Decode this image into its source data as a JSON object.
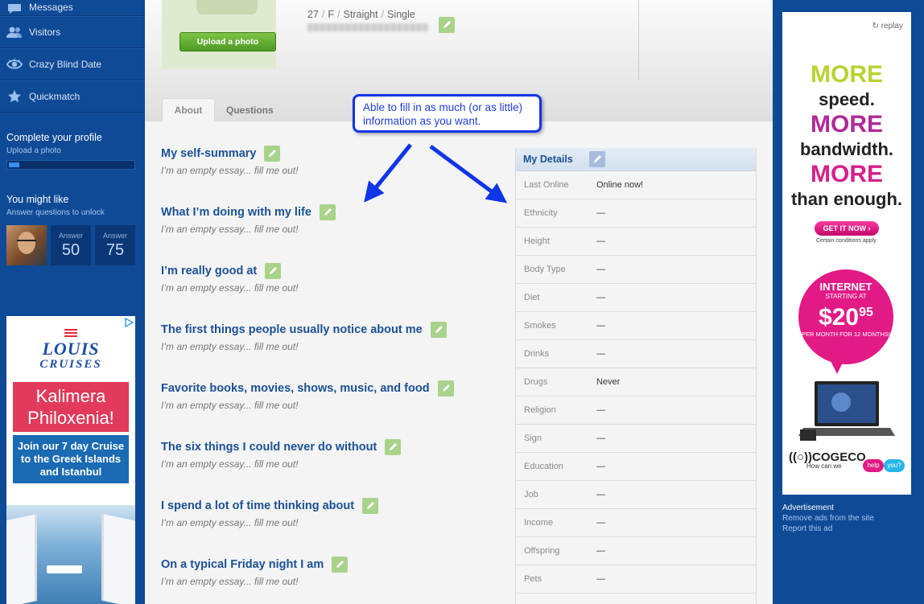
{
  "sidebar": {
    "nav": [
      {
        "label": "Messages",
        "icon": "message-icon"
      },
      {
        "label": "Visitors",
        "icon": "visitors-icon"
      },
      {
        "label": "Crazy Blind Date",
        "icon": "eye-icon"
      },
      {
        "label": "Quickmatch",
        "icon": "star-icon"
      }
    ],
    "complete_profile": {
      "title": "Complete your profile",
      "link": "Upload a photo",
      "progress": 0.08
    },
    "might_like": {
      "title": "You might like",
      "link": "Answer questions to unlock",
      "boxes": [
        {
          "label": "Answer",
          "count": "50"
        },
        {
          "label": "Answer",
          "count": "75"
        }
      ]
    },
    "ad": {
      "brand": "LOUIS",
      "brand_sub": "CRUISES",
      "headline": "Kalimera Philoxenia!",
      "body": "Join our 7 day Cruise to the Greek Islands and Istanbul"
    }
  },
  "profile": {
    "upload_button": "Upload a photo",
    "age": "27",
    "gender": "F",
    "orientation": "Straight",
    "status": "Single"
  },
  "tabs": [
    {
      "label": "About",
      "active": true
    },
    {
      "label": "Questions",
      "active": false
    }
  ],
  "essays": [
    {
      "title": "My self-summary",
      "empty": "I’m an empty essay... fill me out!"
    },
    {
      "title": "What I’m doing with my life",
      "empty": "I’m an empty essay... fill me out!"
    },
    {
      "title": "I’m really good at",
      "empty": "I’m an empty essay... fill me out!"
    },
    {
      "title": "The first things people usually notice about me",
      "empty": "I’m an empty essay... fill me out!"
    },
    {
      "title": "Favorite books, movies, shows, music, and food",
      "empty": "I’m an empty essay... fill me out!"
    },
    {
      "title": "The six things I could never do without",
      "empty": "I’m an empty essay... fill me out!"
    },
    {
      "title": "I spend a lot of time thinking about",
      "empty": "I’m an empty essay... fill me out!"
    },
    {
      "title": "On a typical Friday night I am",
      "empty": "I’m an empty essay... fill me out!"
    }
  ],
  "details": {
    "title": "My Details",
    "rows": [
      {
        "label": "Last Online",
        "value": "Online now!"
      },
      {
        "label": "Ethnicity",
        "value": "—"
      },
      {
        "label": "Height",
        "value": "—"
      },
      {
        "label": "Body Type",
        "value": "—"
      },
      {
        "label": "Diet",
        "value": "—"
      },
      {
        "label": "Smokes",
        "value": "—"
      },
      {
        "label": "Drinks",
        "value": "—"
      },
      {
        "label": "Drugs",
        "value": "Never"
      },
      {
        "label": "Religion",
        "value": "—"
      },
      {
        "label": "Sign",
        "value": "—"
      },
      {
        "label": "Education",
        "value": "—"
      },
      {
        "label": "Job",
        "value": "—"
      },
      {
        "label": "Income",
        "value": "—"
      },
      {
        "label": "Offspring",
        "value": "—"
      },
      {
        "label": "Pets",
        "value": "—"
      }
    ]
  },
  "callout": {
    "text": "Able to fill in as much (or as little) information as you want."
  },
  "right_ad": {
    "replay": "replay",
    "more": "MORE",
    "line1": "speed.",
    "line2": "bandwidth.",
    "line3": "than enough.",
    "cta": "GET IT NOW ›",
    "conditions": "Certain conditions apply.",
    "internet": "INTERNET",
    "starting": "STARTING AT",
    "price": "$20",
    "cents": "95",
    "per": "PER MONTH FOR 12 MONTHS!",
    "brand": "COGECO",
    "tagline": "How can we",
    "help": "help",
    "you": "you?"
  },
  "ad_footer": {
    "label": "Advertisement",
    "remove": "Remove ads from the site",
    "report": "Report this ad"
  },
  "colors": {
    "sidebar": "#0f4a96",
    "essay_title": "#1a5196",
    "pencil": "#a8d38a",
    "callout_border": "#1034e8"
  }
}
